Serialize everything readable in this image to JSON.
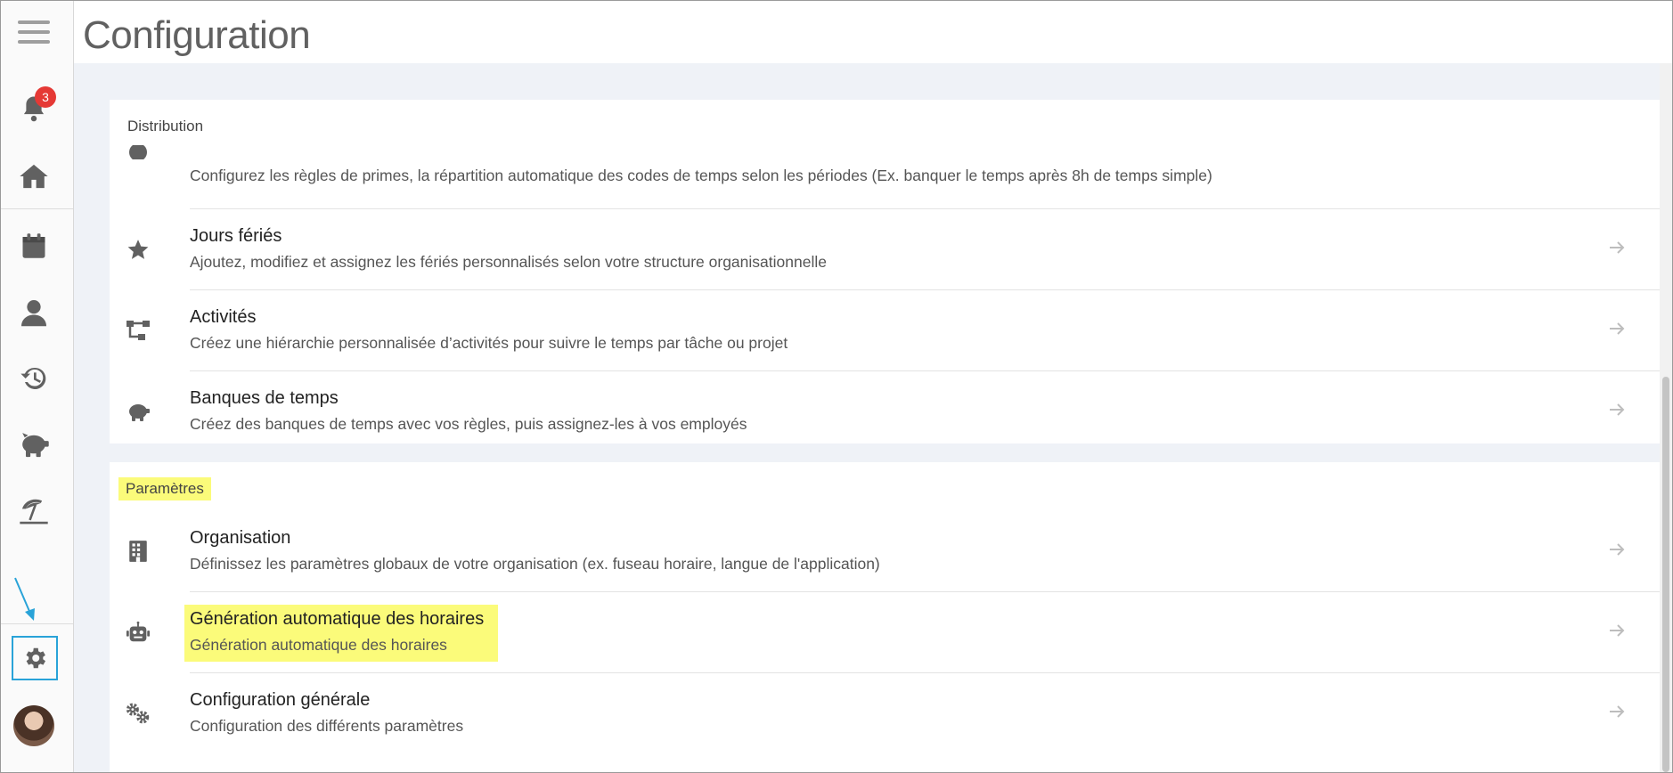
{
  "app": {
    "page_title": "Configuration"
  },
  "sidebar": {
    "notification_count": "3",
    "items": [
      {
        "name": "menu",
        "icon": "hamburger-menu-icon"
      },
      {
        "name": "notifications",
        "icon": "bell-icon"
      },
      {
        "name": "home",
        "icon": "home-icon"
      },
      {
        "name": "calendar",
        "icon": "calendar-icon"
      },
      {
        "name": "employees",
        "icon": "person-icon"
      },
      {
        "name": "history",
        "icon": "history-icon"
      },
      {
        "name": "time-banks",
        "icon": "piggy-bank-icon"
      },
      {
        "name": "vacations",
        "icon": "beach-umbrella-icon"
      },
      {
        "name": "settings",
        "icon": "gear-icon"
      },
      {
        "name": "profile",
        "icon": "avatar"
      }
    ]
  },
  "sections": {
    "distribution": {
      "title": "Distribution",
      "rows": [
        {
          "title": "",
          "desc": "Configurez les règles de primes, la répartition automatique des codes de temps selon les périodes (Ex. banquer le temps après 8h de temps simple)",
          "icon": "clock-24-icon"
        },
        {
          "title": "Jours fériés",
          "desc": "Ajoutez, modifiez et assignez les fériés personnalisés selon votre structure organisationnelle",
          "icon": "star-icon"
        },
        {
          "title": "Activités",
          "desc": "Créez une hiérarchie personnalisée d’activités pour suivre le temps par tâche ou projet",
          "icon": "hierarchy-icon"
        },
        {
          "title": "Banques de temps",
          "desc": "Créez des banques de temps avec vos règles, puis assignez-les à vos employés",
          "icon": "piggy-bank-icon"
        }
      ]
    },
    "parametres": {
      "title": "Paramètres",
      "rows": [
        {
          "title": "Organisation",
          "desc": "Définissez les paramètres globaux de votre organisation (ex. fuseau horaire, langue de l'application)",
          "icon": "building-icon"
        },
        {
          "title": "Génération automatique des horaires",
          "desc": "Génération automatique des horaires",
          "icon": "robot-icon"
        },
        {
          "title": "Configuration générale",
          "desc": "Configuration des différents paramètres",
          "icon": "gears-icon"
        }
      ]
    }
  },
  "colors": {
    "highlight": "#fbfb7a",
    "annotation": "#29a3d8",
    "badge": "#e53935",
    "icon": "#616161"
  }
}
